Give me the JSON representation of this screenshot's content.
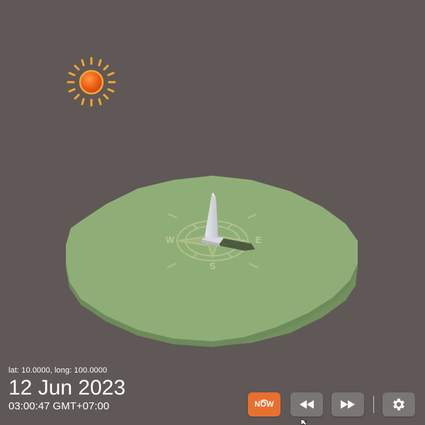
{
  "location": {
    "coords_label": "lat: 10.0000, long: 100.0000"
  },
  "datetime": {
    "date": "12 Jun 2023",
    "time": "03:00:47 GMT+07:00"
  },
  "compass": {
    "west": "W",
    "east": "E",
    "south": "S"
  },
  "controls": {
    "now_label": "NOW",
    "rewind_icon": "rewind-icon",
    "forward_icon": "fast-forward-icon",
    "settings_icon": "gear-icon"
  },
  "colors": {
    "background": "#5f5856",
    "ground": "#8fae77",
    "sun": "#f07a1f",
    "now_button": "#e8702f",
    "button": "#7b7676"
  }
}
